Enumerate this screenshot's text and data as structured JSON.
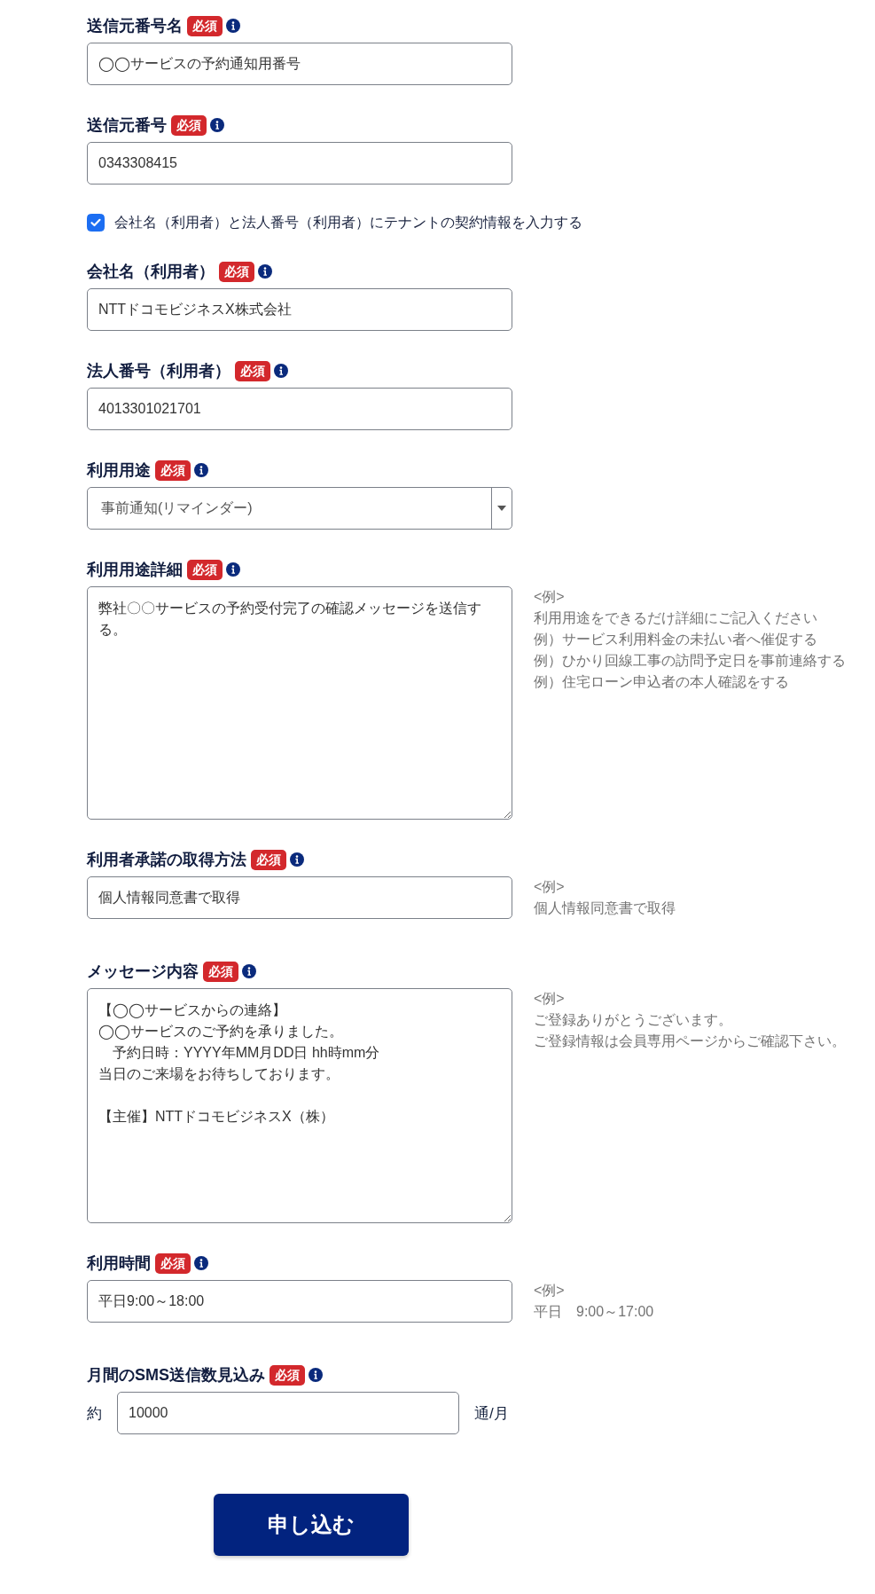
{
  "form": {
    "fields": [
      {
        "kind": "text",
        "label": "送信元番号名",
        "badge": "必須",
        "value": "◯◯サービスの予約通知用番号"
      },
      {
        "kind": "text",
        "label": "送信元番号",
        "badge": "必須",
        "value": "0343308415"
      },
      {
        "kind": "checkbox",
        "label": "会社名（利用者）と法人番号（利用者）にテナントの契約情報を入力する",
        "checked": true
      },
      {
        "kind": "text",
        "label": "会社名（利用者）",
        "badge": "必須",
        "value": "NTTドコモビジネスX株式会社"
      },
      {
        "kind": "text",
        "label": "法人番号（利用者）",
        "badge": "必須",
        "value": "4013301021701"
      },
      {
        "kind": "select",
        "label": "利用用途",
        "badge": "必須",
        "value": "事前通知(リマインダー)"
      },
      {
        "kind": "textarea",
        "label": "利用用途詳細",
        "badge": "必須",
        "value": "弊社〇〇サービスの予約受付完了の確認メッセージを送信する。",
        "example": [
          "<例>",
          "利用用途をできるだけ詳細にご記入ください",
          "例）サービス利用料金の未払い者へ催促する",
          "例）ひかり回線工事の訪問予定日を事前連絡する",
          "例）住宅ローン申込者の本人確認をする"
        ]
      },
      {
        "kind": "text",
        "label": "利用者承諾の取得方法",
        "badge": "必須",
        "value": "個人情報同意書で取得",
        "example": [
          "<例>",
          "個人情報同意書で取得"
        ]
      },
      {
        "kind": "message",
        "label": "メッセージ内容",
        "badge": "必須",
        "paragraphs": [
          {
            "lines": [
              {
                "text": "【◯◯サービスからの連絡】",
                "indented": false
              },
              {
                "text": "◯◯サービスのご予約を承りました。",
                "indented": false
              },
              {
                "text": "予約日時：YYYY年MM月DD日 hh時mm分",
                "indented": true
              },
              {
                "text": "当日のご来場をお待ちしております。",
                "indented": false
              }
            ]
          },
          {
            "lines": [
              {
                "text": "【主催】NTTドコモビジネスX（株）",
                "indented": false
              }
            ]
          }
        ],
        "example": [
          "<例>",
          "ご登録ありがとうございます。",
          "ご登録情報は会員専用ページからご確認下さい。"
        ]
      },
      {
        "kind": "text",
        "label": "利用時間",
        "badge": "必須",
        "value": "平日9:00～18:00",
        "example": [
          "<例>",
          "平日　9:00～17:00"
        ]
      },
      {
        "kind": "number",
        "label": "月間のSMS送信数見込み",
        "badge": "必須",
        "prefix": "約",
        "value": "10000",
        "suffix": "通/月"
      }
    ]
  },
  "submit_button": {
    "label": "申し込む"
  }
}
